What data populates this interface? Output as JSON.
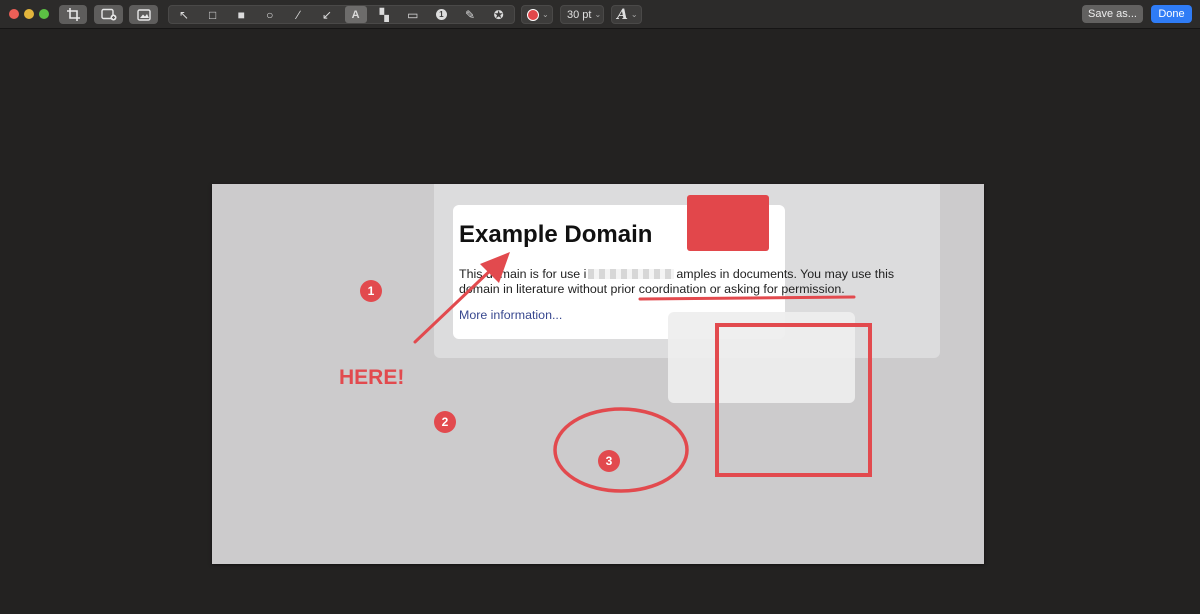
{
  "window": {
    "traffic_lights": {
      "close": "#ec5f57",
      "minimize": "#e3b53c",
      "zoom": "#5cc144"
    }
  },
  "toolbar": {
    "left_buttons": [
      "crop-icon",
      "image-add-icon",
      "image-icon"
    ],
    "tools": [
      {
        "name": "select-arrow-icon",
        "glyph": "↖",
        "active": false
      },
      {
        "name": "rectangle-outline-icon",
        "glyph": "□",
        "active": false
      },
      {
        "name": "rectangle-filled-icon",
        "glyph": "■",
        "active": false
      },
      {
        "name": "ellipse-icon",
        "glyph": "○",
        "active": false
      },
      {
        "name": "line-icon",
        "glyph": "∕",
        "active": false
      },
      {
        "name": "arrow-icon",
        "glyph": "↙",
        "active": false
      },
      {
        "name": "text-tool-icon",
        "glyph": "A",
        "active": true
      },
      {
        "name": "pixelate-icon",
        "glyph": "▚",
        "active": false
      },
      {
        "name": "highlight-box-icon",
        "glyph": "▭",
        "active": false
      },
      {
        "name": "counter-icon",
        "glyph": "1",
        "active": false
      },
      {
        "name": "pencil-icon",
        "glyph": "✎",
        "active": false
      },
      {
        "name": "stamp-icon",
        "glyph": "✪",
        "active": false
      }
    ],
    "color_picker": {
      "value": "#e2474b"
    },
    "font_size": {
      "value": "30 pt"
    },
    "font_style": {
      "icon": "font-style-icon"
    },
    "save_label": "Save as...",
    "done_label": "Done"
  },
  "page": {
    "title": "Example Domain",
    "line1_start": "This domain is for use i",
    "line1_end": "amples in documents. You may use this",
    "line2": "domain in literature without prior coordination or asking for permission.",
    "link": "More information..."
  },
  "annotations": {
    "color": "#e24a4e",
    "badges": [
      "1",
      "2",
      "3"
    ],
    "label": "HERE!"
  }
}
